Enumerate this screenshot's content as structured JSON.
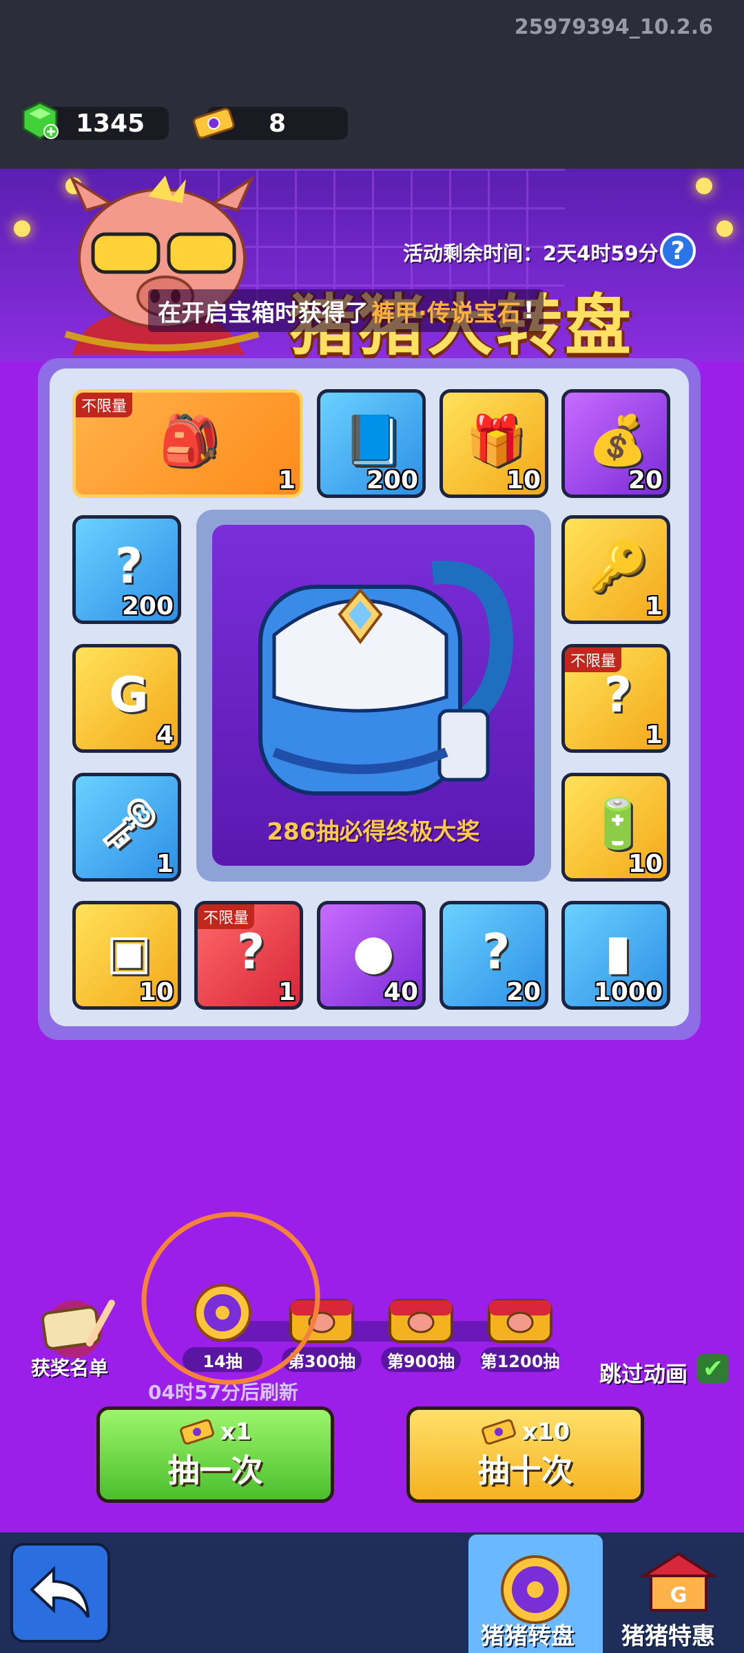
{
  "header": {
    "version": "25979394_10.2.6",
    "gems": "1345",
    "tickets": "8"
  },
  "event": {
    "timer": "活动剩余时间：2天4时59分",
    "help": "?",
    "title": "猪猪大转盘",
    "news_prefix": "在开启宝箱时获得了",
    "news_highlight": "裤甲·传说宝石",
    "news_suffix": "!"
  },
  "board": {
    "grand_prize_text": "286抽必得终极大奖",
    "cells": [
      {
        "qty": "1",
        "tag": "不限量",
        "icon": "backpack-icon",
        "color": "orange"
      },
      {
        "qty": "200",
        "tag": "",
        "icon": "blue-book-icon",
        "color": "blue"
      },
      {
        "qty": "10",
        "tag": "",
        "icon": "green-giftbox-icon",
        "color": "gold"
      },
      {
        "qty": "20",
        "tag": "",
        "icon": "flour-sack-icon",
        "color": "purple"
      },
      {
        "qty": "200",
        "tag": "",
        "icon": "gold-mystery-cube-icon",
        "color": "blue"
      },
      {
        "qty": "1",
        "tag": "",
        "icon": "gold-key-icon",
        "color": "gold"
      },
      {
        "qty": "4",
        "tag": "",
        "icon": "gold-g-cube-icon",
        "color": "gold"
      },
      {
        "qty": "1",
        "tag": "不限量",
        "icon": "gold-mystery-gem-icon",
        "color": "gold"
      },
      {
        "qty": "1",
        "tag": "",
        "icon": "silver-key-icon",
        "color": "blue"
      },
      {
        "qty": "10",
        "tag": "",
        "icon": "green-battery-icon",
        "color": "gold"
      },
      {
        "qty": "10",
        "tag": "",
        "icon": "treasure-chest-icon",
        "color": "gold"
      },
      {
        "qty": "1",
        "tag": "不限量",
        "icon": "red-mystery-gem-icon",
        "color": "red"
      },
      {
        "qty": "40",
        "tag": "",
        "icon": "pig-coin-icon",
        "color": "purple"
      },
      {
        "qty": "20",
        "tag": "",
        "icon": "blue-mystery-cube-icon",
        "color": "blue"
      },
      {
        "qty": "1000",
        "tag": "",
        "icon": "orange-canister-icon",
        "color": "blue"
      }
    ]
  },
  "progress": {
    "milestones": [
      {
        "label": "14抽",
        "icon": "spin-token-icon"
      },
      {
        "label": "第300抽",
        "icon": "pig-chest-icon"
      },
      {
        "label": "第900抽",
        "icon": "pig-chest-icon"
      },
      {
        "label": "第1200抽",
        "icon": "pig-chest-icon"
      }
    ],
    "winners_label": "获奖名单",
    "skip_label": "跳过动画",
    "skip_checked": true,
    "countdown": "04时57分后刷新"
  },
  "buttons": {
    "single": {
      "cost": "x1",
      "label": "抽一次"
    },
    "ten": {
      "cost": "x10",
      "label": "抽十次"
    }
  },
  "nav": {
    "tab1": "猪猪转盘",
    "tab2": "猪猪特惠"
  },
  "colors": {
    "background": "#9b1fe8",
    "accent": "#ffe062",
    "annotation": "#f5823a"
  }
}
